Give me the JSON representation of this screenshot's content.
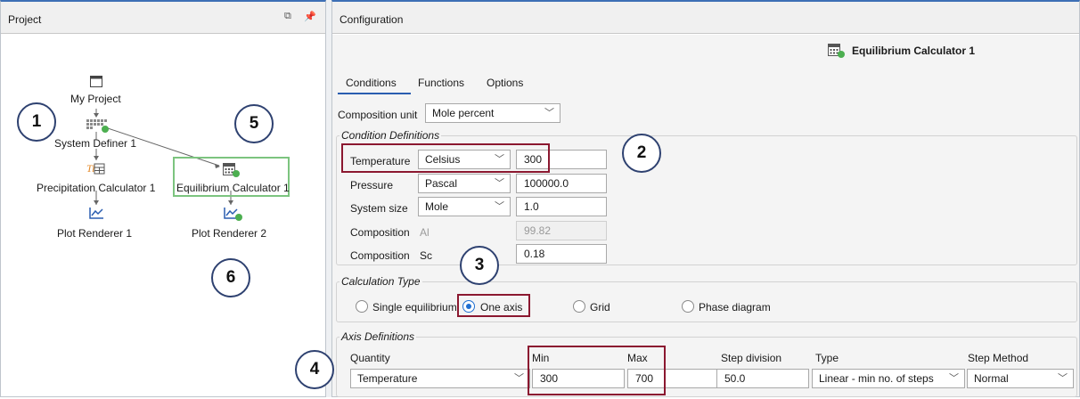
{
  "project_panel": {
    "title": "Project",
    "nodes": {
      "my_project": "My Project",
      "system_definer": "System Definer 1",
      "precipitation_calculator": "Precipitation Calculator 1",
      "equilibrium_calculator": "Equilibrium Calculator 1",
      "plot_renderer_1": "Plot Renderer 1",
      "plot_renderer_2": "Plot Renderer 2"
    },
    "callouts": {
      "c1": "1",
      "c5": "5",
      "c6": "6"
    }
  },
  "config_panel": {
    "title": "Configuration",
    "node_title": "Equilibrium Calculator 1",
    "tabs": [
      "Conditions",
      "Functions",
      "Options"
    ],
    "composition_unit": {
      "label": "Composition unit",
      "value": "Mole percent"
    },
    "condition_definitions": {
      "title": "Condition Definitions",
      "rows": [
        {
          "label": "Temperature",
          "unit": "Celsius",
          "value": "300"
        },
        {
          "label": "Pressure",
          "unit": "Pascal",
          "value": "100000.0"
        },
        {
          "label": "System size",
          "unit": "Mole",
          "value": "1.0"
        },
        {
          "label": "Composition",
          "element": "Al",
          "value": "99.82"
        },
        {
          "label": "Composition",
          "element": "Sc",
          "value": "0.18"
        }
      ]
    },
    "calculation_type": {
      "title": "Calculation Type",
      "options": [
        "Single equilibrium",
        "One axis",
        "Grid",
        "Phase diagram"
      ],
      "selected": "One axis"
    },
    "axis_definitions": {
      "title": "Axis Definitions",
      "headers": {
        "quantity": "Quantity",
        "min": "Min",
        "max": "Max",
        "step_division": "Step division",
        "type": "Type",
        "step_method": "Step Method"
      },
      "row": {
        "quantity": "Temperature",
        "min": "300",
        "max": "700",
        "step_division": "50.0",
        "type": "Linear - min no. of steps",
        "step_method": "Normal"
      }
    },
    "callouts": {
      "c2": "2",
      "c3": "3",
      "c4": "4"
    }
  },
  "colors": {
    "accent": "#2a5db0",
    "highlight": "#8b1830",
    "callout_border": "#2e4170",
    "node_dot": "#4caf50"
  }
}
